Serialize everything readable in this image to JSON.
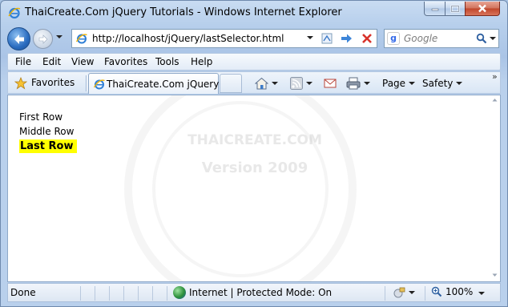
{
  "window": {
    "title": "ThaiCreate.Com jQuery Tutorials - Windows Internet Explorer"
  },
  "nav": {
    "address": "http://localhost/jQuery/lastSelector.html",
    "search_placeholder": "Google"
  },
  "menu": {
    "items": [
      "File",
      "Edit",
      "View",
      "Favorites",
      "Tools",
      "Help"
    ]
  },
  "favbar": {
    "favorites_label": "Favorites",
    "tab_title": "ThaiCreate.Com jQuery ...",
    "page_label": "Page",
    "safety_label": "Safety"
  },
  "page": {
    "rows": [
      "First Row",
      "Middle Row",
      "Last Row"
    ],
    "highlight_color": "#ffff00",
    "watermark_brand": "THAICREATE.COM",
    "watermark_version": "Version 2009"
  },
  "status": {
    "text": "Done",
    "zone": "Internet | Protected Mode: On",
    "zoom": "100%"
  },
  "colors": {
    "close_button": "#c0452a",
    "chrome": "#b9d0ec"
  }
}
